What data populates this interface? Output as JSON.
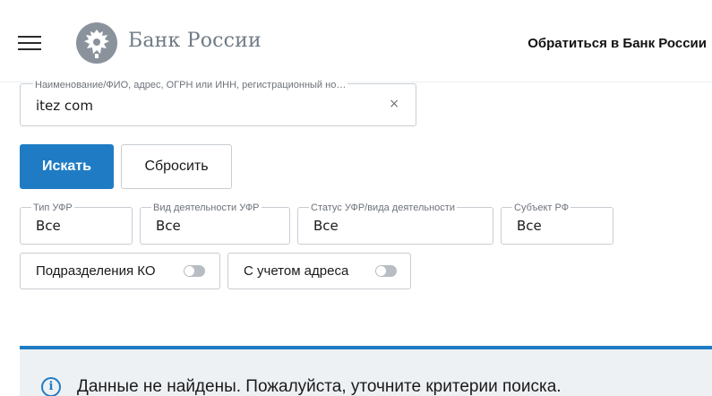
{
  "header": {
    "logo_text": "Банк России",
    "contact_link": "Обратиться в Банк России",
    "icons": {
      "menu": "hamburger-menu-icon",
      "emblem": "double-headed-eagle-emblem"
    }
  },
  "search": {
    "label": "Наименование/ФИО, адрес, ОГРН или ИНН, регистрационный но…",
    "value": "itez com",
    "clear_glyph": "×"
  },
  "buttons": {
    "search_label": "Искать",
    "reset_label": "Сбросить"
  },
  "filters": [
    {
      "label": "Тип УФР",
      "value": "Все"
    },
    {
      "label": "Вид деятельности УФР",
      "value": "Все"
    },
    {
      "label": "Статус УФР/вида деятельности",
      "value": "Все"
    },
    {
      "label": "Субъект РФ",
      "value": "Все"
    }
  ],
  "toggles": [
    {
      "label": "Подразделения КО",
      "on": false
    },
    {
      "label": "С учетом адреса",
      "on": false
    }
  ],
  "notice": {
    "text": "Данные не найдены. Пожалуйста, уточните критерии поиска.",
    "icon_glyph": "i"
  },
  "colors": {
    "accent": "#1f7cc4",
    "notice_bg": "#eef1f4",
    "border": "#c9cdd2"
  }
}
